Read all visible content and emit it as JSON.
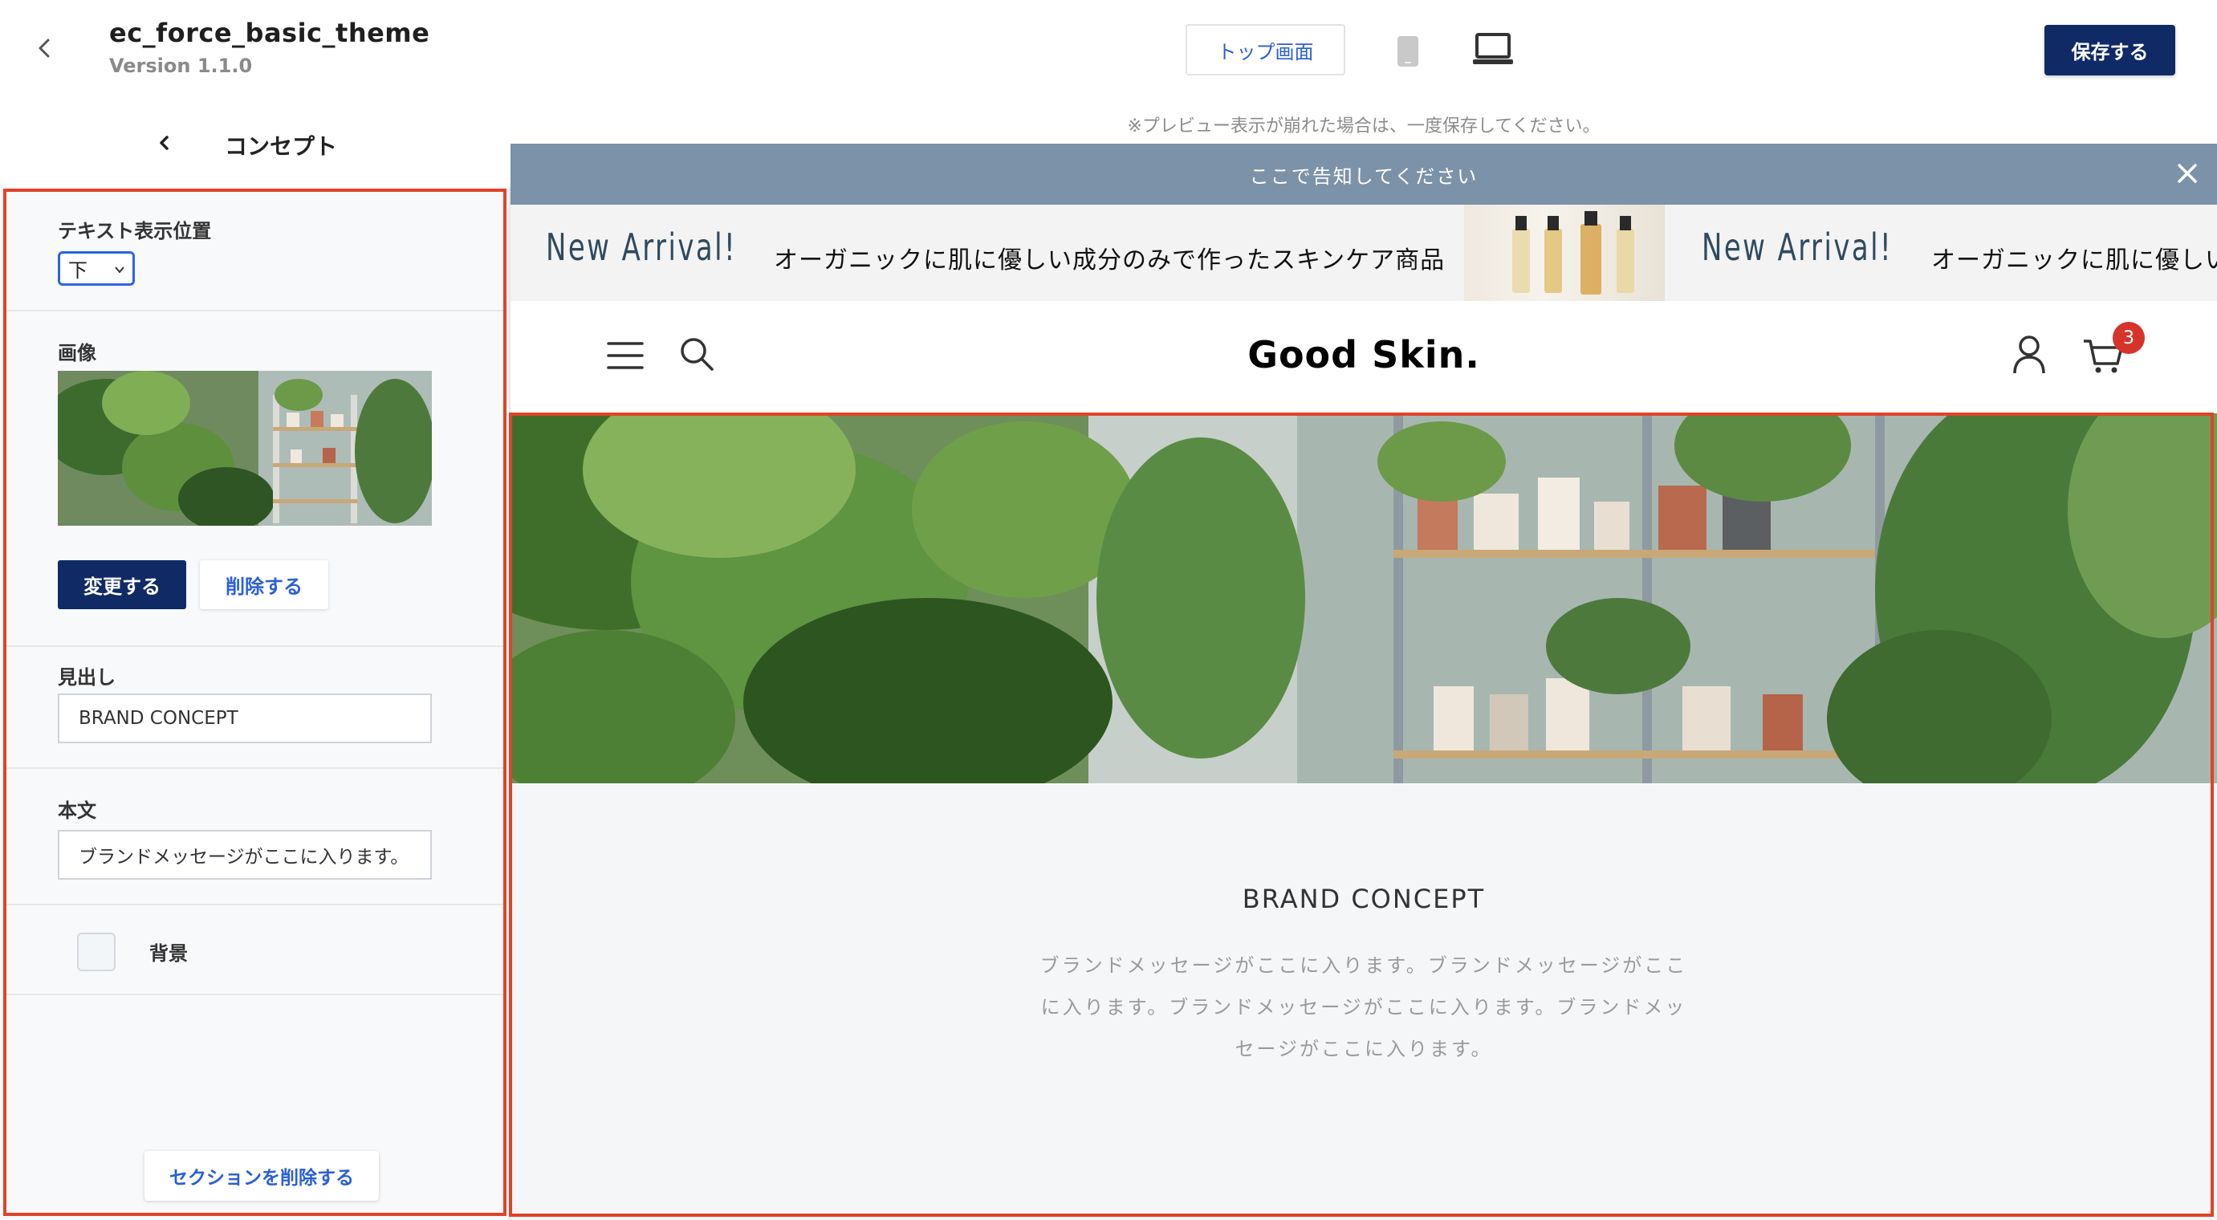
{
  "header": {
    "theme_name": "ec_force_basic_theme",
    "version": "Version 1.1.0",
    "top_screen_label": "トップ画面",
    "save_label": "保存する"
  },
  "panel": {
    "section_title": "コンセプト",
    "text_position_label": "テキスト表示位置",
    "text_position_value": "下",
    "image_label": "画像",
    "change_label": "変更する",
    "delete_label": "削除する",
    "heading_label": "見出し",
    "heading_value": "BRAND CONCEPT",
    "body_label": "本文",
    "body_value": "ブランドメッセージがここに入ります。ブラ",
    "background_label": "背景",
    "remove_section_label": "セクションを削除する"
  },
  "preview": {
    "note": "※プレビュー表示が崩れた場合は、一度保存してください。",
    "announcement": "ここで告知してください",
    "banner_arrival": "New Arrival!",
    "banner_text": "オーガニックに肌に優しい成分のみで作ったスキンケア商品",
    "banner_text_2": "オーガニックに肌に優しい",
    "logo": "Good Skin.",
    "cart_count": "3",
    "concept_title": "BRAND CONCEPT",
    "concept_body": "ブランドメッセージがここに入ります。ブランドメッセージがここに入ります。ブランドメッセージがここに入ります。ブランドメッセージがここに入ります。"
  },
  "colors": {
    "primary": "#102a66",
    "link": "#2a5fd6",
    "highlight": "#e04328",
    "announce_bg": "#7b92a8",
    "badge": "#d6342b"
  }
}
